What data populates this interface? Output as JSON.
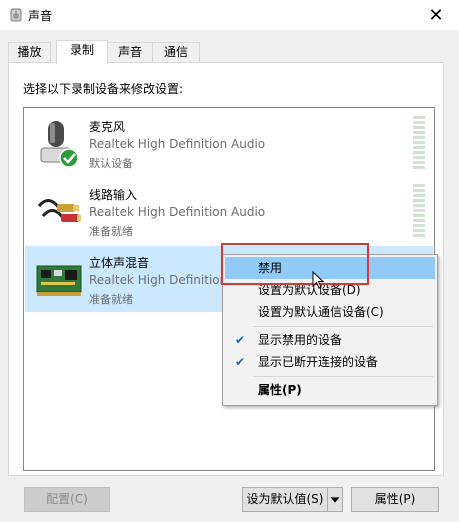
{
  "window": {
    "title": "声音",
    "close_glyph": "✕"
  },
  "tabs": [
    {
      "label": "播放"
    },
    {
      "label": "录制"
    },
    {
      "label": "声音"
    },
    {
      "label": "通信"
    }
  ],
  "panel": {
    "instruction": "选择以下录制设备来修改设置:",
    "devices": [
      {
        "name": "麦克风",
        "driver": "Realtek High Definition Audio",
        "status": "默认设备",
        "icon": "microphone-icon"
      },
      {
        "name": "线路输入",
        "driver": "Realtek High Definition Audio",
        "status": "准备就绪",
        "icon": "line-in-icon"
      },
      {
        "name": "立体声混音",
        "driver": "Realtek High Definition",
        "status": "准备就绪",
        "icon": "sound-card-icon"
      }
    ]
  },
  "context_menu": {
    "items": [
      {
        "label": "禁用"
      },
      {
        "label": "设置为默认设备(D)"
      },
      {
        "label": "设置为默认通信设备(C)"
      },
      {
        "label": "显示禁用的设备",
        "checked": true
      },
      {
        "label": "显示已断开连接的设备",
        "checked": true
      },
      {
        "label": "属性(P)"
      }
    ],
    "check_glyph": "✔"
  },
  "buttons": {
    "configure": "配置(C)",
    "set_default": "设为默认值(S)",
    "properties": "属性(P)"
  },
  "colors": {
    "selection": "#cce8ff",
    "highlight": "#91c9f7",
    "annotation": "#d23a3a"
  }
}
